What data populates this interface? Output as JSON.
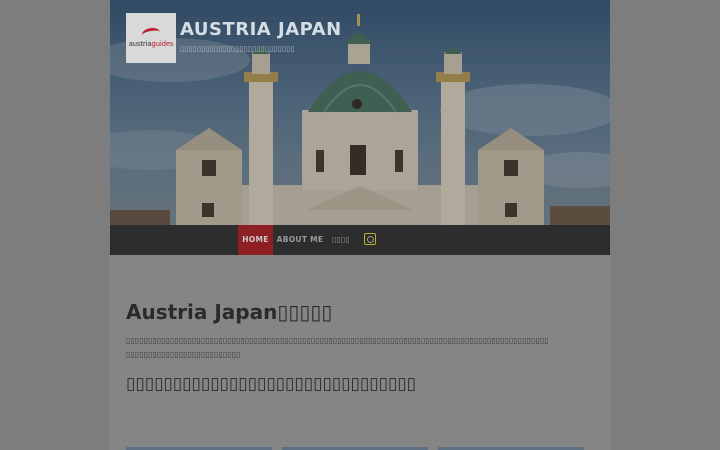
{
  "site": {
    "title": "AUSTRIA JAPAN",
    "tagline": "▯▯▯▯▯▯▯▯▯▯▯▯▯▯▯▯▯▯▯▯▯▯▯▯▯▯▯",
    "logo": {
      "prefix": "austria",
      "suffix": "guides"
    }
  },
  "nav": {
    "items": [
      "HOME",
      "ABOUT ME",
      "▯▯▯▯"
    ],
    "active": "HOME",
    "social_icon": "instagram-icon"
  },
  "main": {
    "heading": "Austria Japan▯▯▯▯▯",
    "paragraph": "▯▯▯▯▯▯▯▯▯▯▯▯▯▯▯▯▯▯▯▯▯▯▯▯▯▯▯▯▯▯▯▯▯▯▯▯▯▯▯▯▯▯▯▯▯▯▯▯▯▯▯▯▯▯▯▯▯▯▯▯▯▯▯▯▯▯▯▯▯▯▯▯▯▯▯▯▯▯▯▯▯▯▯▯▯▯▯▯▯▯▯▯▯▯▯▯ ▯▯▯▯▯▯▯▯▯▯▯▯▯▯▯▯▯▯▯▯▯▯▯▯▯▯",
    "subheading": "▯▯▯▯▯▯▯▯▯▯▯▯▯▯▯▯▯▯▯▯▯▯▯▯▯▯▯▯▯▯▯"
  },
  "colors": {
    "nav_bg": "#2d2d2d",
    "nav_active": "#8e1f22",
    "overlay": "#7d7d7d",
    "accent": "#b9b222"
  }
}
